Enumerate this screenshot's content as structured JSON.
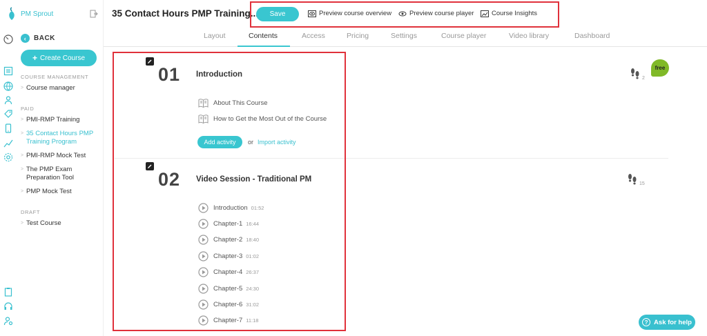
{
  "brand": {
    "name": "PM Sprout",
    "accent": "#39c6d0"
  },
  "sidebar": {
    "back_label": "BACK",
    "create_label": "Create Course",
    "sections": {
      "management": "COURSE MANAGEMENT",
      "paid": "PAID",
      "draft": "DRAFT"
    },
    "management_items": [
      "Course manager"
    ],
    "paid_items": [
      "PMI-RMP Training",
      "35 Contact Hours PMP Training Program",
      "PMI-RMP Mock Test",
      "The PMP Exam Preparation Tool",
      "PMP Mock Test"
    ],
    "draft_items": [
      "Test Course"
    ]
  },
  "header": {
    "course_title": "35 Contact Hours PMP Training...",
    "save_label": "Save",
    "preview_overview": "Preview course overview",
    "preview_player": "Preview course player",
    "insights": "Course Insights"
  },
  "tabs": [
    "Layout",
    "Contents",
    "Access",
    "Pricing",
    "Settings",
    "Course player",
    "Video library",
    "Dashboard"
  ],
  "active_tab": "Contents",
  "sections": [
    {
      "number": "01",
      "title": "Introduction",
      "badge": "free",
      "views": "2",
      "activities": [
        {
          "title": "About This Course"
        },
        {
          "title": "How to Get the Most Out of the Course"
        }
      ],
      "add_activity": "Add activity",
      "or": "or",
      "import_activity": "Import activity"
    },
    {
      "number": "02",
      "title": "Video Session - Traditional PM",
      "views": "15",
      "activities": [
        {
          "title": "Introduction",
          "duration": "01:52"
        },
        {
          "title": "Chapter-1",
          "duration": "16:44"
        },
        {
          "title": "Chapter-2",
          "duration": "18:40"
        },
        {
          "title": "Chapter-3",
          "duration": "01:02"
        },
        {
          "title": "Chapter-4",
          "duration": "26:37"
        },
        {
          "title": "Chapter-5",
          "duration": "24:30"
        },
        {
          "title": "Chapter-6",
          "duration": "31:02"
        },
        {
          "title": "Chapter-7",
          "duration": "11:18"
        }
      ]
    }
  ],
  "help_label": "Ask for help",
  "colors": {
    "highlight_box": "#e0303a",
    "free_badge": "#80b928"
  }
}
